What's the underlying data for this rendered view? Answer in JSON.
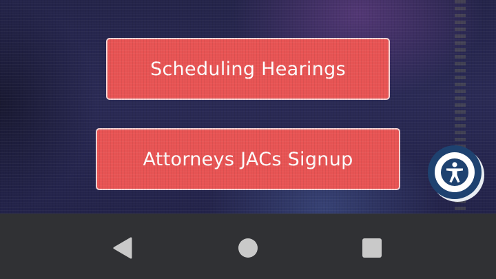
{
  "hero": {
    "buttons": {
      "scheduling_hearings": "Scheduling Hearings",
      "attorneys_jacs_signup": "Attorneys JACs Signup"
    }
  },
  "accessibility": {
    "icon": "accessibility-person-icon"
  },
  "navigation_bar": {
    "icons": [
      "back-triangle-icon",
      "home-circle-icon",
      "recents-square-icon"
    ]
  },
  "colors": {
    "button_background": "#e85454",
    "button_border": "#f4d6d6",
    "button_text": "#ffffff",
    "accessibility_background": "#1e4270",
    "nav_bar_background": "#303134",
    "nav_icon": "#c9c9c9"
  }
}
